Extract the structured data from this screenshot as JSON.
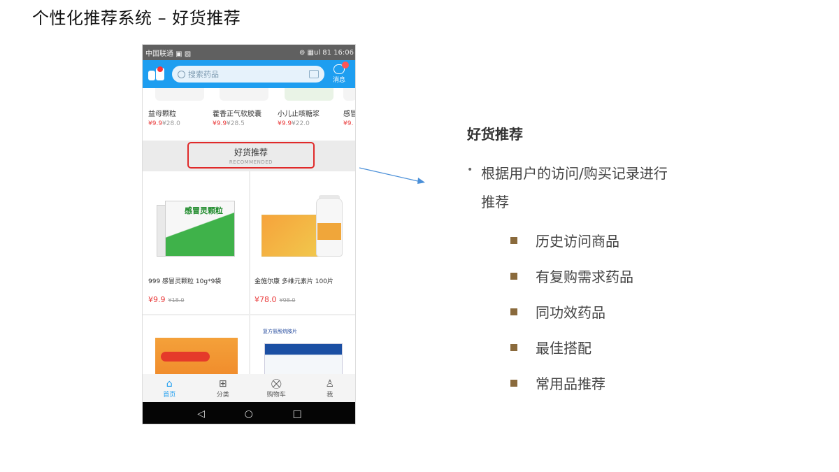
{
  "slide": {
    "title": "个性化推荐系统 – 好货推荐"
  },
  "phone": {
    "status_left": "中国联通 ▣ ▨",
    "status_right": "⊚ ▦ul 81 16:06",
    "search_placeholder": "搜索药品",
    "message_label": "消息",
    "strip_items": [
      {
        "name": "益母颗粒",
        "price": "¥9.9",
        "old_price": "¥28.0"
      },
      {
        "name": "藿香正气软胶囊",
        "price": "¥9.9",
        "old_price": "¥28.5"
      },
      {
        "name": "小儿止咳糖浆",
        "price": "¥9.9",
        "old_price": "¥22.0"
      },
      {
        "name": "感冒",
        "price": "¥9.",
        "old_price": ""
      }
    ],
    "section_title": "好货推荐",
    "section_subtitle": "RECOMMENDED",
    "products": [
      {
        "name": "999 感冒灵颗粒 10g*9袋",
        "price": "¥9.9",
        "old_price": "¥18.0",
        "box_label": "感冒灵颗粒"
      },
      {
        "name": "金施尔康 多维元素片 100片",
        "price": "¥78.0",
        "old_price": "¥98.0"
      }
    ],
    "blue_box_label": "复方氨酚烷胺片",
    "nav": [
      {
        "icon": "⌂",
        "label": "首页"
      },
      {
        "icon": "⊞",
        "label": "分类"
      },
      {
        "icon": "⛒",
        "label": "购物车"
      },
      {
        "icon": "♙",
        "label": "我"
      }
    ],
    "android_keys": [
      "◁",
      "○",
      "□"
    ]
  },
  "panel": {
    "heading": "好货推荐",
    "bullet": "根据用户的访问/购买记录进行推荐",
    "sub_items": [
      "历史访问商品",
      "有复购需求药品",
      "同功效药品",
      "最佳搭配",
      "常用品推荐"
    ]
  },
  "colors": {
    "header_blue": "#1e9ef0",
    "highlight_red": "#e02a2a",
    "price_red": "#e93a3a",
    "bullet_square": "#8a6a3c",
    "arrow_blue": "#4a8fd8"
  }
}
